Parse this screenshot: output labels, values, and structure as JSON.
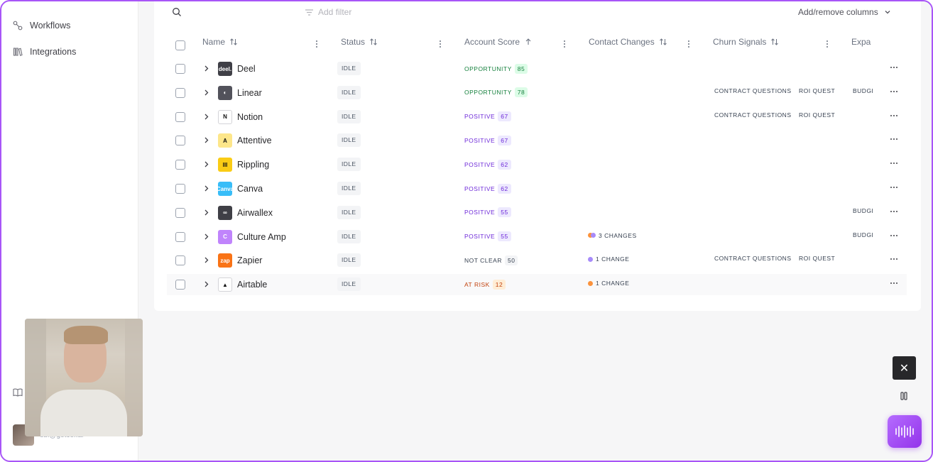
{
  "sidebar": {
    "items": [
      {
        "label": "Workflows",
        "icon": "workflows-icon"
      },
      {
        "label": "Integrations",
        "icon": "integrations-icon"
      }
    ],
    "user_email": "obi@getcor.ai"
  },
  "toolbar": {
    "filter_placeholder": "Add filter",
    "columns_label": "Add/remove columns"
  },
  "table": {
    "columns": [
      "Name",
      "Status",
      "Account Score",
      "Contact Changes",
      "Churn Signals",
      "Expa"
    ],
    "rows": [
      {
        "name": "Deel",
        "logo_color": "#3f3f46",
        "logo_text": "deel.",
        "status": "IDLE",
        "score_label": "OPPORTUNITY",
        "score": "85",
        "score_kind": "opportunity",
        "changes": "",
        "change_colors": [],
        "signals": [],
        "expansion": ""
      },
      {
        "name": "Linear",
        "logo_color": "#52525b",
        "logo_text": "◐",
        "status": "IDLE",
        "score_label": "OPPORTUNITY",
        "score": "78",
        "score_kind": "opportunity",
        "changes": "",
        "change_colors": [],
        "signals": [
          "CONTRACT QUESTIONS",
          "ROI QUESTI"
        ],
        "expansion": "BUDGI"
      },
      {
        "name": "Notion",
        "logo_color": "#ffffff",
        "logo_text": "N",
        "status": "IDLE",
        "score_label": "POSITIVE",
        "score": "67",
        "score_kind": "positive",
        "changes": "",
        "change_colors": [],
        "signals": [
          "CONTRACT QUESTIONS",
          "ROI QUESTI"
        ],
        "expansion": ""
      },
      {
        "name": "Attentive",
        "logo_color": "#fde68a",
        "logo_text": "A",
        "status": "IDLE",
        "score_label": "POSITIVE",
        "score": "67",
        "score_kind": "positive",
        "changes": "",
        "change_colors": [],
        "signals": [],
        "expansion": ""
      },
      {
        "name": "Rippling",
        "logo_color": "#facc15",
        "logo_text": "III",
        "status": "IDLE",
        "score_label": "POSITIVE",
        "score": "62",
        "score_kind": "positive",
        "changes": "",
        "change_colors": [],
        "signals": [],
        "expansion": ""
      },
      {
        "name": "Canva",
        "logo_color": "#38bdf8",
        "logo_text": "Canva",
        "status": "IDLE",
        "score_label": "POSITIVE",
        "score": "62",
        "score_kind": "positive",
        "changes": "",
        "change_colors": [],
        "signals": [],
        "expansion": ""
      },
      {
        "name": "Airwallex",
        "logo_color": "#3f3f46",
        "logo_text": "∞",
        "status": "IDLE",
        "score_label": "POSITIVE",
        "score": "55",
        "score_kind": "positive",
        "changes": "",
        "change_colors": [],
        "signals": [],
        "expansion": "BUDGI"
      },
      {
        "name": "Culture Amp",
        "logo_color": "#c084fc",
        "logo_text": "C",
        "status": "IDLE",
        "score_label": "POSITIVE",
        "score": "55",
        "score_kind": "positive",
        "changes": "3 CHANGES",
        "change_colors": [
          "#fb923c",
          "#a78bfa"
        ],
        "signals": [],
        "expansion": "BUDGI"
      },
      {
        "name": "Zapier",
        "logo_color": "#f97316",
        "logo_text": "zap",
        "status": "IDLE",
        "score_label": "NOT CLEAR",
        "score": "50",
        "score_kind": "neutral",
        "changes": "1 CHANGE",
        "change_colors": [
          "#a78bfa"
        ],
        "signals": [
          "CONTRACT QUESTIONS",
          "ROI QUESTI"
        ],
        "expansion": ""
      },
      {
        "name": "Airtable",
        "logo_color": "#ffffff",
        "logo_text": "▲",
        "status": "IDLE",
        "score_label": "AT RISK",
        "score": "12",
        "score_kind": "risk",
        "changes": "1 CHANGE",
        "change_colors": [
          "#fb923c"
        ],
        "signals": [],
        "expansion": ""
      }
    ]
  },
  "colors": {
    "accent": "#a855f7",
    "opportunity_text": "#15803d",
    "opportunity_bg": "#dcfce7",
    "positive_text": "#6d28d9",
    "positive_bg": "#ede9fe",
    "neutral_bg": "#f3f4f6",
    "risk_text": "#c2410c",
    "risk_bg": "#ffedd5"
  }
}
